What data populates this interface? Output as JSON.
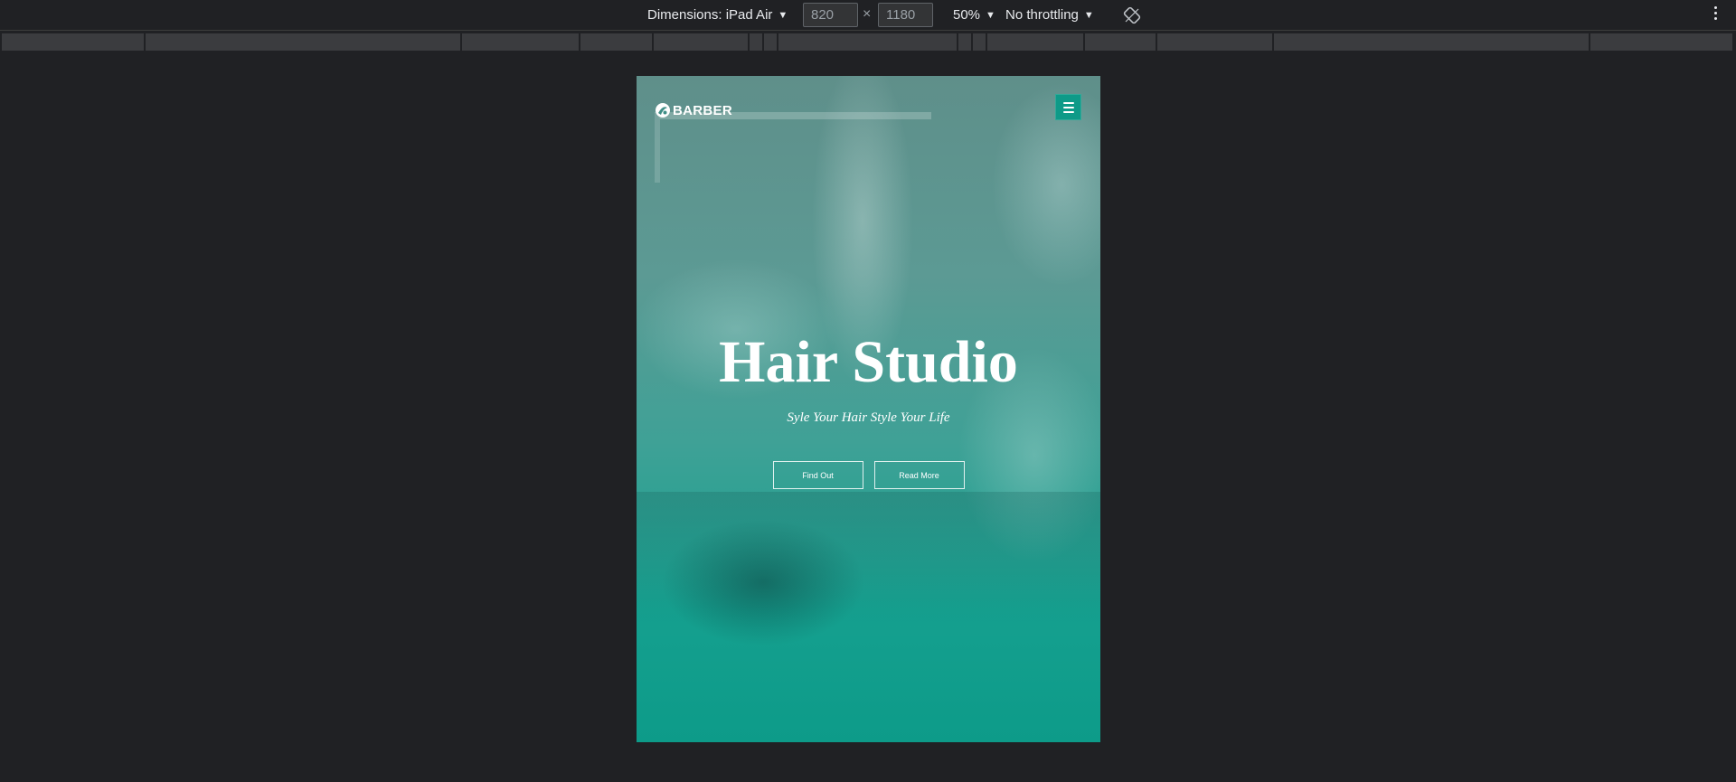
{
  "devtools": {
    "dimensions_label": "Dimensions: iPad Air",
    "width_value": "820",
    "height_value": "1180",
    "times_symbol": "×",
    "zoom_label": "50%",
    "throttling_label": "No throttling",
    "caret": "▼",
    "rotate_icon": "rotate-icon",
    "more_icon": "more-vertical-icon"
  },
  "site": {
    "logo_text": "BARBER",
    "logo_icon": "barber-logo-icon",
    "menu_icon": "hamburger-menu-icon",
    "hero_title": "Hair Studio",
    "hero_subtitle": "Syle Your Hair Style Your Life",
    "buttons": [
      {
        "label": "Find Out"
      },
      {
        "label": "Read More"
      }
    ],
    "colors": {
      "accent": "#0e9a88",
      "devtools_bg": "#202124"
    }
  }
}
